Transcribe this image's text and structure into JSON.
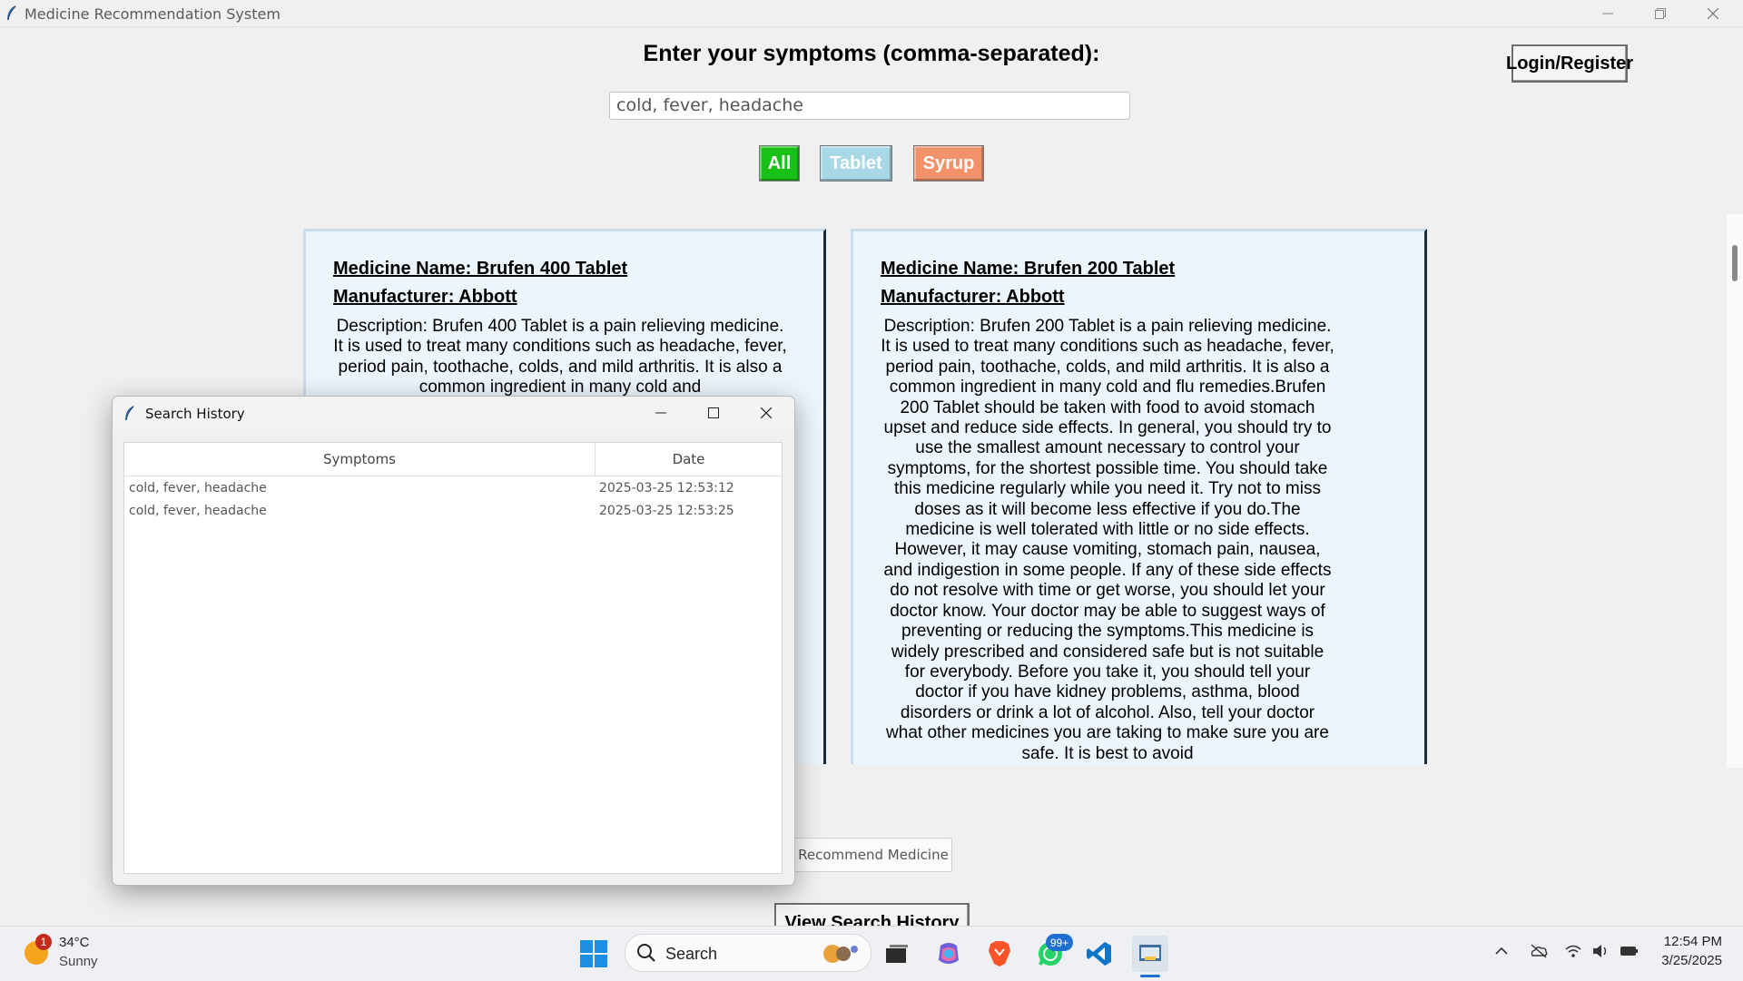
{
  "window": {
    "title": "Medicine Recommendation System"
  },
  "header": {
    "prompt": "Enter your symptoms (comma-separated):",
    "login_label": "Login/Register",
    "symptoms_value": "cold, fever, headache"
  },
  "filters": {
    "all": "All",
    "tablet": "Tablet",
    "syrup": "Syrup",
    "colors": {
      "all": "#18c018",
      "tablet": "#a8d8e6",
      "syrup": "#f2926a"
    }
  },
  "cards": [
    {
      "name": "Medicine Name: Brufen 400 Tablet",
      "manufacturer": "Manufacturer: Abbott",
      "description": "Description: Brufen 400 Tablet is a pain relieving medicine. It is used to treat many conditions such as headache, fever, period pain, toothache, colds, and mild arthritis. It is also a common ingredient in many cold and"
    },
    {
      "name": "Medicine Name: Brufen 200 Tablet",
      "manufacturer": "Manufacturer: Abbott",
      "description": "Description: Brufen 200 Tablet is a pain relieving medicine. It is used to treat many conditions such as headache, fever, period pain, toothache, colds, and mild arthritis. It is also a common ingredient in many cold and flu remedies.Brufen 200 Tablet should be taken with food to avoid stomach upset and reduce side effects. In general, you should try to use the smallest amount necessary to control your symptoms, for the shortest possible time. You should take this medicine regularly while you need it. Try not to miss doses as it will become less effective if you do.The medicine is well tolerated with little or no side effects. However, it may cause vomiting, stomach pain, nausea, and indigestion in some people. If any of these side effects do not resolve with time or get worse, you should let your doctor know. Your doctor may be able to suggest ways of preventing or reducing the symptoms.This medicine is widely prescribed and considered safe but is not suitable for everybody. Before you take it, you should tell your doctor if you have kidney problems, asthma, blood disorders or drink a lot of alcohol. Also, tell your doctor what other medicines you are taking to make sure you are safe. It is best to avoid"
    }
  ],
  "actions": {
    "recommend": "Recommend Medicine",
    "view_history": "View Search History"
  },
  "history_window": {
    "title": "Search History",
    "columns": {
      "symptoms": "Symptoms",
      "date": "Date"
    },
    "rows": [
      {
        "symptoms": "cold, fever, headache",
        "date": "2025-03-25 12:53:12"
      },
      {
        "symptoms": "cold, fever, headache",
        "date": "2025-03-25 12:53:25"
      }
    ]
  },
  "taskbar": {
    "weather_badge": "1",
    "temperature": "34°C",
    "condition": "Sunny",
    "search_label": "Search",
    "notification_badge": "99+",
    "time": "12:54 PM",
    "date": "3/25/2025"
  }
}
